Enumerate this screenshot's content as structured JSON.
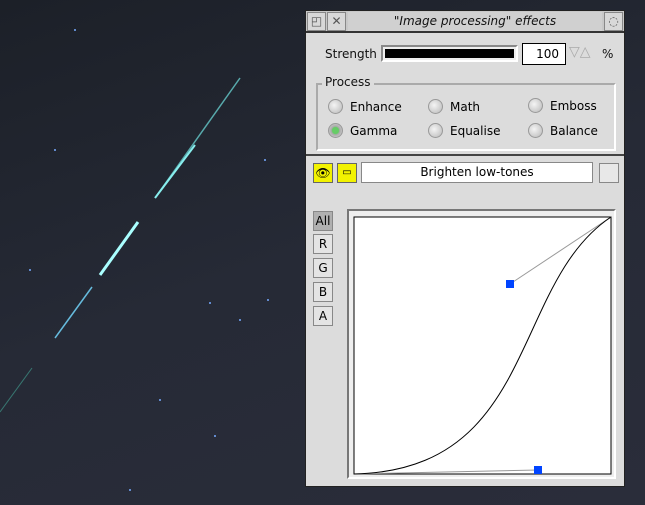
{
  "window": {
    "title": "\"Image processing\" effects"
  },
  "strength": {
    "label": "Strength",
    "value": "100",
    "unit": "%",
    "level_percent": 100
  },
  "process": {
    "label": "Process",
    "options": [
      {
        "label": "Enhance",
        "selected": false
      },
      {
        "label": "Math",
        "selected": false
      },
      {
        "label": "Emboss",
        "selected": false
      },
      {
        "label": "Gamma",
        "selected": true
      },
      {
        "label": "Equalise",
        "selected": false
      },
      {
        "label": "Balance",
        "selected": false
      }
    ]
  },
  "preset": {
    "value": "Brighten low-tones"
  },
  "channels": [
    "All",
    "R",
    "G",
    "B",
    "A"
  ],
  "active_channel": "All",
  "colors": {
    "handle": "#0044ff",
    "toggle": "#f2f200",
    "window": "#dcdcdc"
  }
}
